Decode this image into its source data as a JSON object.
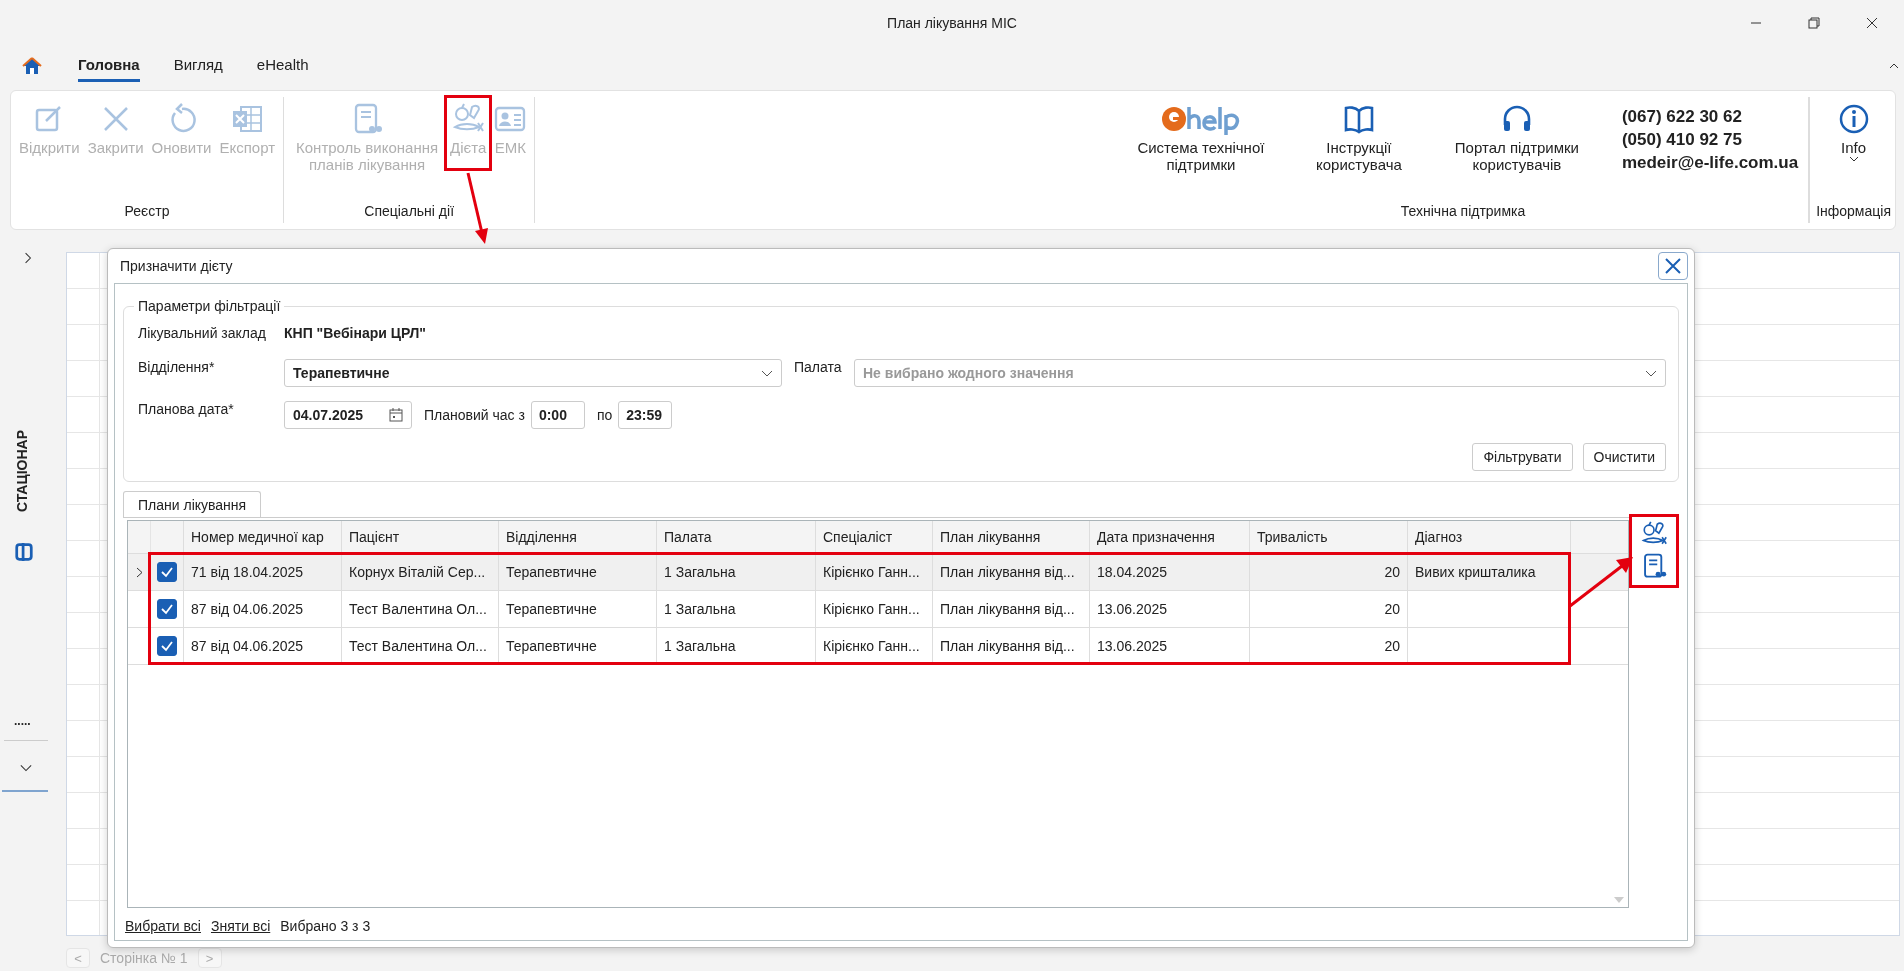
{
  "window": {
    "title": "План лікування МІС"
  },
  "tabs": [
    {
      "label": "Головна",
      "selected": true
    },
    {
      "label": "Вигляд",
      "selected": false
    },
    {
      "label": "eHealth",
      "selected": false
    }
  ],
  "ribbon": {
    "groups": [
      {
        "label": "Реєстр",
        "buttons": [
          {
            "label": "Відкрити",
            "disabled": true
          },
          {
            "label": "Закрити",
            "disabled": true
          },
          {
            "label": "Оновити",
            "disabled": true
          },
          {
            "label": "Експорт",
            "disabled": true
          }
        ]
      },
      {
        "label": "Спеціальні дії",
        "buttons": [
          {
            "label": "Контроль виконання планів лікування",
            "disabled": true
          },
          {
            "label": "Дієта",
            "disabled": true
          },
          {
            "label": "ЕМК",
            "disabled": true
          }
        ]
      }
    ],
    "support": {
      "label": "Технічна підтримка",
      "buttons": [
        {
          "label": "Система технічної підтримки"
        },
        {
          "label": "Інструкції користувача"
        },
        {
          "label": "Портал підтримки користувачів"
        }
      ],
      "phones": [
        "(067) 622 30 62",
        "(050) 410 92 75"
      ],
      "email": "medeir@e-life.com.ua"
    },
    "info": {
      "label": "Інформація",
      "button": "Info"
    }
  },
  "sidebar": {
    "label": "СТАЦІОНАР",
    "more": "....."
  },
  "pager": {
    "page": "Сторінка № 1",
    "prev": "<",
    "next": ">"
  },
  "dialog": {
    "title": "Призначити дієту",
    "filter": {
      "legend": "Параметри фільтрації",
      "facility_label": "Лікувальний заклад",
      "facility": "КНП \"Вебінари ЦРЛ\"",
      "department_label": "Відділення*",
      "department": "Терапевтичне",
      "ward_label": "Палата",
      "ward_placeholder": "Не вибрано жодного значення",
      "date_label": "Планова дата*",
      "date": "04.07.2025",
      "time_label": "Плановий час з",
      "time_from": "0:00",
      "time_to_label": "по",
      "time_to": "23:59",
      "buttons": [
        "Фільтрувати",
        "Очистити"
      ]
    },
    "tab": "Плани лікування",
    "table": {
      "columns": [
        {
          "label": "Номер медичної кар",
          "kind": "text"
        },
        {
          "label": "Пацієнт",
          "kind": "text"
        },
        {
          "label": "Відділення",
          "kind": "text"
        },
        {
          "label": "Палата",
          "kind": "text"
        },
        {
          "label": "Спеціаліст",
          "kind": "text"
        },
        {
          "label": "План лікування",
          "kind": "text"
        },
        {
          "label": "Дата призначення",
          "kind": "text"
        },
        {
          "label": "Тривалість",
          "kind": "number"
        },
        {
          "label": "Діагноз",
          "kind": "text"
        }
      ],
      "rows": [
        {
          "selected": true,
          "checked": true,
          "cells": [
            "71 від 18.04.2025",
            "Корнух Віталій Сер...",
            "Терапевтичне",
            "1 Загальна",
            "Кірієнко Ганн...",
            "План лікування від...",
            "18.04.2025",
            "20",
            "Вивих кришталика"
          ]
        },
        {
          "selected": false,
          "checked": true,
          "cells": [
            "87 від 04.06.2025",
            "Тест Валентина Ол...",
            "Терапевтичне",
            "1 Загальна",
            "Кірієнко Ганн...",
            "План лікування від...",
            "13.06.2025",
            "20",
            ""
          ]
        },
        {
          "selected": false,
          "checked": true,
          "cells": [
            "87 від 04.06.2025",
            "Тест Валентина Ол...",
            "Терапевтичне",
            "1 Загальна",
            "Кірієнко Ганн...",
            "План лікування від...",
            "13.06.2025",
            "20",
            ""
          ]
        }
      ]
    },
    "footer": {
      "select_all": "Вибрати всі",
      "deselect_all": "Зняти всі",
      "count": "Вибрано 3 з 3"
    }
  }
}
